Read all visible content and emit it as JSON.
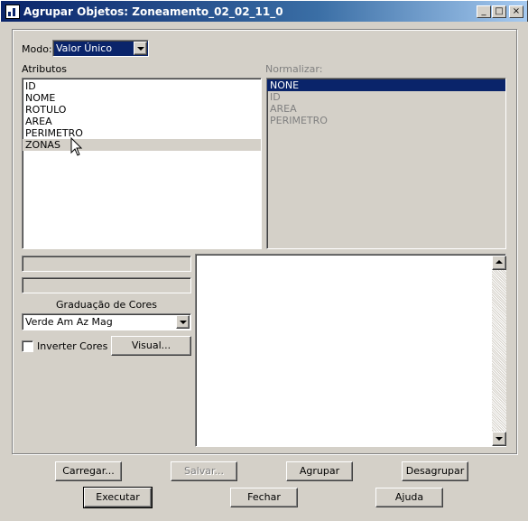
{
  "window": {
    "title": "Agrupar Objetos: Zoneamento_02_02_11_0",
    "minimize": "_",
    "maximize": "□",
    "close": "×"
  },
  "modo": {
    "label": "Modo:",
    "value": "Valor Único"
  },
  "atributos": {
    "label": "Atributos",
    "items": [
      "ID",
      "NOME",
      "ROTULO",
      "AREA",
      "PERIMETRO",
      "ZONAS"
    ],
    "selected": "ZONAS"
  },
  "normalizar": {
    "label": "Normalizar:",
    "items": [
      "NONE",
      "ID",
      "AREA",
      "PERIMETRO"
    ],
    "selected": "NONE"
  },
  "graduacao": {
    "label": "Graduação de Cores",
    "value": "Verde Am Az Mag"
  },
  "inverter": {
    "label": "Inverter Cores",
    "checked": false
  },
  "buttons": {
    "visual": "Visual...",
    "carregar": "Carregar...",
    "salvar": "Salvar...",
    "agrupar": "Agrupar",
    "desagrupar": "Desagrupar",
    "executar": "Executar",
    "fechar": "Fechar",
    "ajuda": "Ajuda"
  },
  "colors": {
    "title_start": "#0a246a",
    "title_end": "#a6caf0",
    "face": "#d4d0c8",
    "selection": "#0a246a"
  }
}
